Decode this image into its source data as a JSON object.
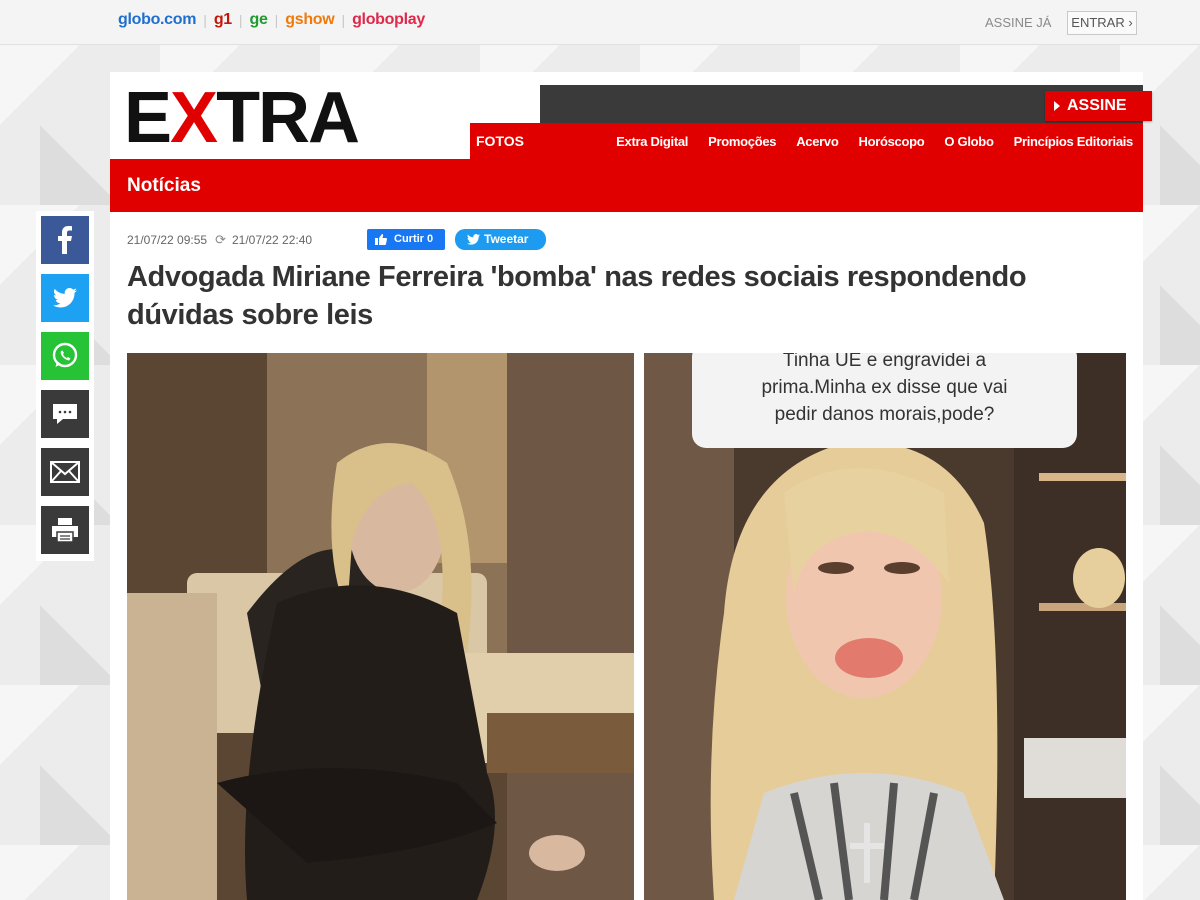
{
  "globo_bar": {
    "links": [
      {
        "label": "globo.com",
        "cls": "lnk-globo"
      },
      {
        "label": "g1",
        "cls": "lnk-g1"
      },
      {
        "label": "ge",
        "cls": "lnk-ge"
      },
      {
        "label": "gshow",
        "cls": "lnk-gshow"
      },
      {
        "label": "globoplay",
        "cls": "lnk-globoplay"
      }
    ],
    "assine_ja": "ASSINE JÁ",
    "entrar": "ENTRAR ›"
  },
  "header": {
    "logo_pre": "E",
    "logo_x": "X",
    "logo_post": "TRA",
    "assine": "ASSINE",
    "section_link": "FOTOS",
    "nav": [
      "Extra Digital",
      "Promoções",
      "Acervo",
      "Horóscopo",
      "O Globo",
      "Princípios Editoriais"
    ],
    "section_title": "Notícias"
  },
  "article": {
    "published": "21/07/22 09:55",
    "updated": "21/07/22 22:40",
    "like_label": "Curtir 0",
    "tweet_label": "Tweetar",
    "headline": "Advogada Miriane Ferreira 'bomba' nas redes sociais respondendo dúvidas sobre leis",
    "photo_right_caption_lines": [
      "Tinha UE e engravidei a",
      "prima.Minha ex disse que vai",
      "pedir danos morais,pode?"
    ]
  },
  "share_icons": [
    "facebook-icon",
    "twitter-icon",
    "whatsapp-icon",
    "comment-icon",
    "email-icon",
    "print-icon"
  ],
  "colors": {
    "brand_red": "#e10000",
    "facebook": "#3b5998",
    "twitter": "#1da1f2",
    "whatsapp": "#25c335"
  }
}
